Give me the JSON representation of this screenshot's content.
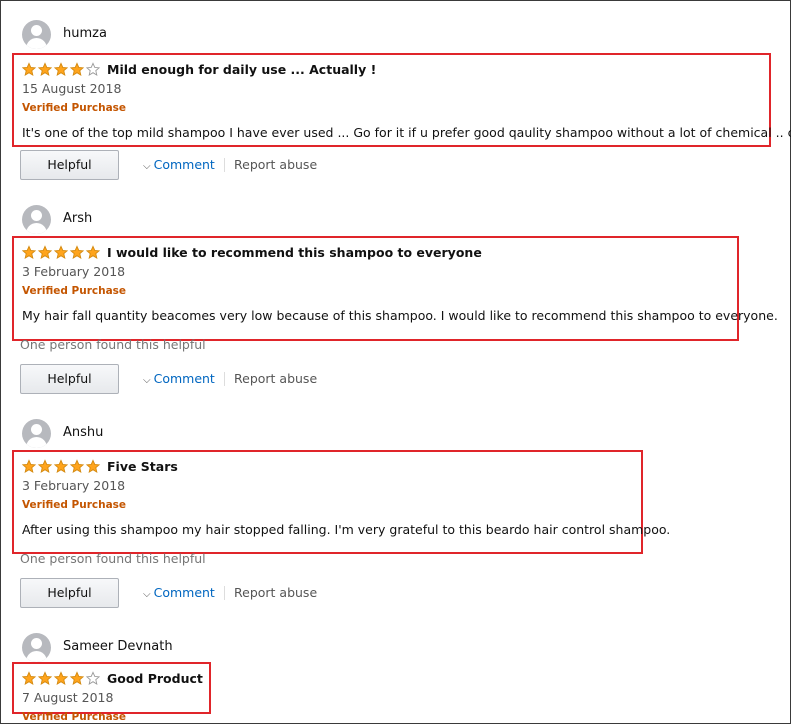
{
  "colors": {
    "star": "#ffa41c",
    "verified": "#c45500",
    "link": "#0066c0",
    "highlight": "#e0252a"
  },
  "icons": {
    "avatar": "default-profile-avatar-icon",
    "star_full": "star-full-icon",
    "star_empty": "star-empty-icon",
    "chevron": "chevron-down-icon"
  },
  "reviews": [
    {
      "author": "humza",
      "rating": 4,
      "title": "Mild enough for daily use ... Actually !",
      "date": "15 August 2018",
      "badge": "Verified Purchase",
      "body": "It's one of the top mild shampoo I have ever used ... Go for it if u prefer good qaulity shampoo without a lot of chemical .. chao",
      "helpful_count_text": "",
      "helpful_label": "Helpful",
      "comment_label": "Comment",
      "report_label": "Report abuse"
    },
    {
      "author": "Arsh",
      "rating": 5,
      "title": "I would like to recommend this shampoo to everyone",
      "date": "3 February 2018",
      "badge": "Verified Purchase",
      "body": "My hair fall quantity beacomes very low because of this shampoo. I would like to recommend this shampoo to everyone.",
      "helpful_count_text": "One person found this helpful",
      "helpful_label": "Helpful",
      "comment_label": "Comment",
      "report_label": "Report abuse"
    },
    {
      "author": "Anshu",
      "rating": 5,
      "title": "Five Stars",
      "date": "3 February 2018",
      "badge": "Verified Purchase",
      "body": "After using this shampoo my hair stopped falling. I'm very grateful to this beardo hair control shampoo.",
      "helpful_count_text": "One person found this helpful",
      "helpful_label": "Helpful",
      "comment_label": "Comment",
      "report_label": "Report abuse"
    },
    {
      "author": "Sameer Devnath",
      "rating": 4,
      "title": "Good Product",
      "date": "7 August 2018",
      "badge": "Verified Purchase"
    }
  ]
}
